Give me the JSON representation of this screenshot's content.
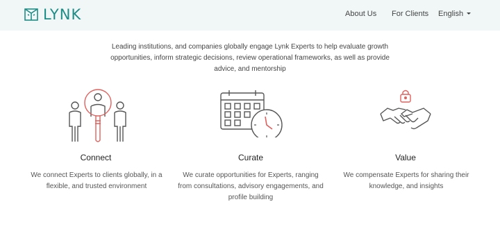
{
  "header": {
    "brand": "LYNK",
    "nav": {
      "about": "About Us",
      "clients": "For Clients",
      "language": "English"
    }
  },
  "intro": "Leading institutions, and companies globally engage Lynk Experts to help evaluate growth opportunities, inform strategic decisions, review operational frameworks, as well as provide advice, and mentorship",
  "features": [
    {
      "title": "Connect",
      "text": "We connect Experts to clients globally, in a flexible, and trusted environment",
      "icon": "people-magnifier-icon"
    },
    {
      "title": "Curate",
      "text": "We curate opportunities for Experts, ranging from consultations, advisory engagements, and profile building",
      "icon": "calendar-clock-icon"
    },
    {
      "title": "Value",
      "text": "We compensate Experts for sharing their knowledge, and insights",
      "icon": "handshake-lock-icon"
    }
  ],
  "colors": {
    "header_bg": "#f1f7f7",
    "brand": "#1e8c86",
    "accent": "#e0605c",
    "line": "#555555"
  }
}
